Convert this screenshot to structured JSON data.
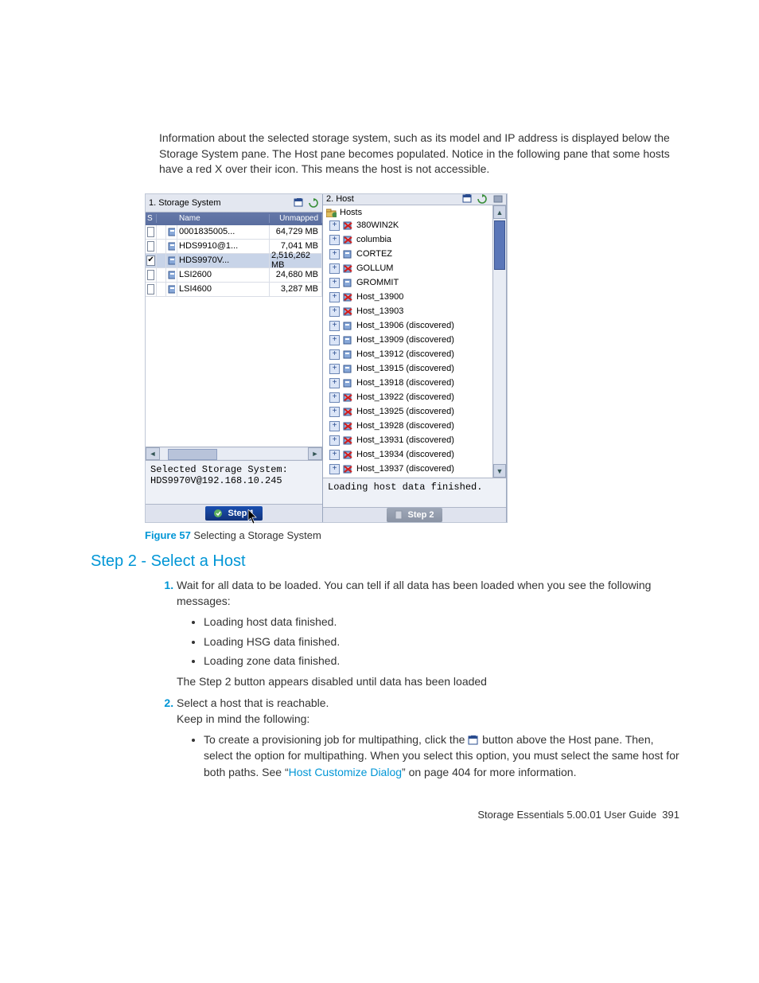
{
  "intro": "Information about the selected storage system, such as its model and IP address  is displayed below the Storage System pane. The Host pane becomes populated. Notice in the following pane that some hosts have a red X over their icon. This means the host is not accessible.",
  "shot": {
    "left": {
      "title": "1. Storage System",
      "cols": {
        "s": "S",
        "name": "Name",
        "unmapped": "Unmapped"
      },
      "rows": [
        {
          "checked": false,
          "name": "0001835005...",
          "unmapped": "64,729 MB",
          "sel": false
        },
        {
          "checked": false,
          "name": "HDS9910@1...",
          "unmapped": "7,041 MB",
          "sel": false
        },
        {
          "checked": true,
          "name": "HDS9970V...",
          "unmapped": "2,516,262 MB",
          "sel": true
        },
        {
          "checked": false,
          "name": "LSI2600",
          "unmapped": "24,680 MB",
          "sel": false
        },
        {
          "checked": false,
          "name": "LSI4600",
          "unmapped": "3,287 MB",
          "sel": false
        }
      ],
      "status_line1": "Selected Storage System:",
      "status_line2": "HDS9970V@192.168.10.245",
      "step_label": "Step 1"
    },
    "right": {
      "title": "2. Host",
      "root": "Hosts",
      "items": [
        {
          "label": "380WIN2K",
          "bad": true
        },
        {
          "label": "columbia",
          "bad": true
        },
        {
          "label": "CORTEZ",
          "bad": false
        },
        {
          "label": "GOLLUM",
          "bad": true
        },
        {
          "label": "GROMMIT",
          "bad": false
        },
        {
          "label": "Host_13900",
          "bad": true
        },
        {
          "label": "Host_13903",
          "bad": true
        },
        {
          "label": "Host_13906 (discovered)",
          "bad": false
        },
        {
          "label": "Host_13909 (discovered)",
          "bad": false
        },
        {
          "label": "Host_13912 (discovered)",
          "bad": false
        },
        {
          "label": "Host_13915 (discovered)",
          "bad": false
        },
        {
          "label": "Host_13918 (discovered)",
          "bad": false
        },
        {
          "label": "Host_13922 (discovered)",
          "bad": true
        },
        {
          "label": "Host_13925 (discovered)",
          "bad": true
        },
        {
          "label": "Host_13928 (discovered)",
          "bad": true
        },
        {
          "label": "Host_13931 (discovered)",
          "bad": true
        },
        {
          "label": "Host_13934 (discovered)",
          "bad": true
        },
        {
          "label": "Host_13937 (discovered)",
          "bad": true
        }
      ],
      "status": "Loading host data finished.",
      "step_label": "Step 2"
    }
  },
  "caption": {
    "num": "Figure 57",
    "text": " Selecting a Storage System"
  },
  "step2_heading": "Step 2 - Select a Host",
  "list": {
    "item1": "Wait for all data to be loaded. You can tell if all data has been loaded when you see the following messages:",
    "item1_bullets": [
      "Loading host data finished.",
      "Loading HSG data finished.",
      "Loading zone data finished."
    ],
    "item1_after": "The Step 2 button appears disabled until data has been loaded",
    "item2": "Select a host that is reachable.",
    "item2_after": "Keep in mind the following:",
    "item2_bullet_pre": "To create a provisioning job for multipathing, click the ",
    "item2_bullet_post": " button above the Host pane. Then, select the option for multipathing. When you select this option, you must select the same host for both paths. See “",
    "item2_bullet_link": "Host Customize Dialog",
    "item2_bullet_end": "” on page 404 for more information."
  },
  "footer": {
    "title": "Storage Essentials 5.00.01 User Guide",
    "page": "391"
  }
}
